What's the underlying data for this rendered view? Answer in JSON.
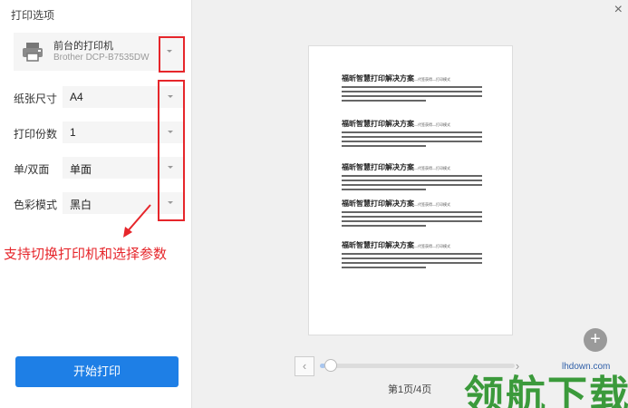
{
  "panel": {
    "title": "打印选项",
    "printer": {
      "name": "前台的打印机",
      "model": "Brother DCP-B7535DW"
    },
    "options": [
      {
        "label": "纸张尺寸",
        "value": "A4"
      },
      {
        "label": "打印份数",
        "value": "1"
      },
      {
        "label": "单/双面",
        "value": "单面"
      },
      {
        "label": "色彩模式",
        "value": "黑白"
      }
    ],
    "annotation": "支持切换打印机和选择参数",
    "start_button": "开始打印"
  },
  "preview": {
    "close_symbol": "×",
    "zoom_in_symbol": "+",
    "prev_symbol": "‹",
    "next_symbol": "›",
    "page_indicator": "第1页/4页",
    "slider_position": 0.03,
    "doc_blocks": [
      {
        "title": "福昕智慧打印解决方案",
        "sub": "—代签获得—打印模式"
      },
      {
        "title": "福昕智慧打印解决方案",
        "sub": "—代签获得—打印模式"
      },
      {
        "title": "福昕智慧打印解决方案",
        "sub": "—代签获得—打印模式"
      },
      {
        "title": "福昕智慧打印解决方案",
        "sub": "—代签获得—打印模式"
      },
      {
        "title": "福昕智慧打印解决方案",
        "sub": "—代签获得—打印模式"
      }
    ]
  },
  "watermark": {
    "text": "领航下载",
    "url": "lhdown.com"
  },
  "colors": {
    "primary": "#1e7fe6",
    "annotation": "#e6262b",
    "watermark": "#3b9a3b"
  },
  "icons": {
    "printer": "printer-icon",
    "dropdown": "chevron-down-icon"
  }
}
